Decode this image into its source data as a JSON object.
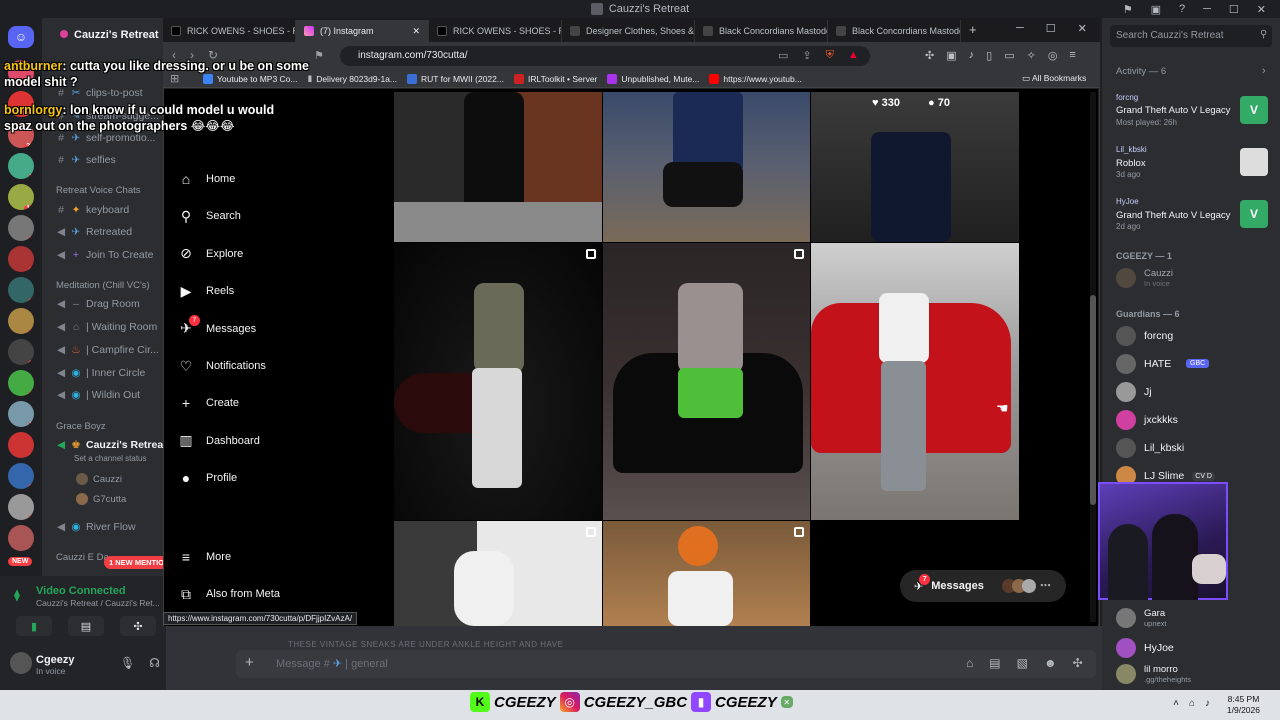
{
  "discord": {
    "window_title": "Cauzzi's Retreat",
    "server_name": "Cauzzi's Retreat",
    "channels": [
      {
        "label": "clips-to-post",
        "icon": "hash"
      },
      {
        "label": "stream-sugge...",
        "icon": "hash"
      },
      {
        "label": "self-promotio...",
        "icon": "hash"
      },
      {
        "label": "selfies",
        "icon": "hash"
      }
    ],
    "voice_category": "Retreat Voice Chats",
    "voice_channels": [
      {
        "label": "keyboard",
        "icon": "hash"
      },
      {
        "label": "Retreated",
        "icon": "speaker"
      },
      {
        "label": "Join To Create",
        "icon": "speaker"
      }
    ],
    "chill_category": "Meditation (Chill VC's)",
    "chill_channels": [
      {
        "label": "Drag Room"
      },
      {
        "label": "| Waiting Room"
      },
      {
        "label": "| Campfire Cir..."
      },
      {
        "label": "| Inner Circle"
      },
      {
        "label": "| Wildin Out"
      }
    ],
    "grace_category": "Grace Boyz",
    "active_channel": "Cauzzi's Retrea...",
    "channel_status": "Set a channel status",
    "voice_users": [
      "Cauzzi",
      "G7cutta"
    ],
    "river_channel": "River Flow",
    "next_category": "Cauzzi E Da...",
    "new_mentions": "1 NEW MENTIO...",
    "new_badge": "NEW",
    "voice_connected": "Video Connected",
    "voice_server": "Cauzzi's Retreat / Cauzzi's Ret...",
    "username": "Cgeezy",
    "user_status": "In voice",
    "message_placeholder": "Message #",
    "message_channel": "| general",
    "preview_text": "THESE VINTAGE SNEAKS ARE UNDER ANKLE HEIGHT AND HAVE",
    "server_badges": [
      "20",
      "26",
      "22",
      "7",
      "14",
      "2",
      "8",
      "6",
      "6",
      "3",
      "6",
      "7",
      "4",
      "6",
      "2",
      "6"
    ]
  },
  "members": {
    "search_placeholder": "Search Cauzzi's Retreat",
    "activity_header": "Activity — 6",
    "activities": [
      {
        "user": "forcng",
        "game": "Grand Theft Auto V Legacy",
        "detail": "Most played: 26h"
      },
      {
        "user": "Lil_kbski",
        "game": "Roblox",
        "detail": "3d ago"
      },
      {
        "user": "HyJoe",
        "game": "Grand Theft Auto V Legacy",
        "detail": "2d ago"
      }
    ],
    "cgeezy_header": "CGEEZY — 1",
    "cgeezy_member": "Cauzzi",
    "cgeezy_status": "In voice",
    "guardians_header": "Guardians — 6",
    "guardians": [
      "forcng",
      "HATE",
      "Jj",
      "jxckkks",
      "Lil_kbski",
      "LJ Slime"
    ],
    "hate_tag": "GBC",
    "ljslime_tag": "CV D",
    "others": [
      {
        "name": "Gara",
        "status": "upnext"
      },
      {
        "name": "HyJoe",
        "status": ""
      },
      {
        "name": "lil morro",
        "status": ".gg/theheights"
      }
    ]
  },
  "browser": {
    "tabs": [
      {
        "label": "RICK OWENS - SHOES - Ric",
        "active": false
      },
      {
        "label": "(7) Instagram",
        "active": true
      },
      {
        "label": "RICK OWENS - SHOES - Ric",
        "active": false
      },
      {
        "label": "Designer Clothes, Shoes &",
        "active": false
      },
      {
        "label": "Black Concordians Mastodo",
        "active": false
      },
      {
        "label": "Black Concordians Mastodo",
        "active": false
      }
    ],
    "url": "instagram.com/730cutta/",
    "bookmarks": [
      "Youtube to MP3 Co...",
      "Delivery 8023d9-1a...",
      "RUT for MWII (2022...",
      "IRLToolkit • Server",
      "Unpublished, Mute...",
      "https://www.youtub..."
    ],
    "all_bookmarks": "All Bookmarks",
    "status_url": "https://www.instagram.com/730cutta/p/DFjjpIZvAzA/"
  },
  "instagram": {
    "nav": [
      {
        "label": "Home",
        "icon": "home-icon"
      },
      {
        "label": "Search",
        "icon": "search-icon"
      },
      {
        "label": "Explore",
        "icon": "compass-icon"
      },
      {
        "label": "Reels",
        "icon": "reels-icon"
      },
      {
        "label": "Messages",
        "icon": "messenger-icon",
        "badge": "7"
      },
      {
        "label": "Notifications",
        "icon": "heart-icon"
      },
      {
        "label": "Create",
        "icon": "plus-icon"
      },
      {
        "label": "Dashboard",
        "icon": "chart-icon"
      },
      {
        "label": "Profile",
        "icon": "avatar-icon"
      }
    ],
    "more": "More",
    "also_meta": "Also from Meta",
    "hover_likes": "330",
    "hover_comments": "70",
    "messages_pill": "Messages",
    "messages_badge": "7"
  },
  "overlay": {
    "chat": [
      {
        "name": "antburner",
        "text": ": cutta you like dressing. or u be on some model shit ?"
      },
      {
        "name": "bornlorgy",
        "text": ": lon know if u could model u would spaz out on the photographers 😂😂😂"
      }
    ],
    "socials": [
      "CGEEZY",
      "CGEEZY_GBC",
      "CGEEZY"
    ]
  },
  "taskbar": {
    "time": "8:45 PM",
    "date": "1/9/2026"
  }
}
